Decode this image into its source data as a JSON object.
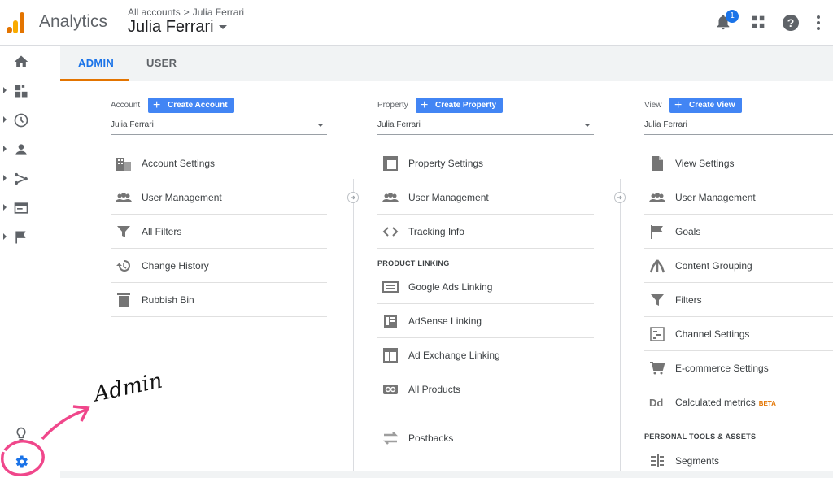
{
  "header": {
    "app_name": "Analytics",
    "breadcrumb": {
      "root": "All accounts",
      "separator": ">",
      "current": "Julia Ferrari"
    },
    "account_name": "Julia Ferrari",
    "notification_count": "1"
  },
  "tabs": [
    {
      "label": "ADMIN"
    },
    {
      "label": "USER"
    }
  ],
  "columns": {
    "account": {
      "label": "Account",
      "create_label": "Create Account",
      "selected": "Julia Ferrari",
      "items": [
        {
          "label": "Account Settings",
          "icon": "building-icon"
        },
        {
          "label": "User Management",
          "icon": "people-icon"
        },
        {
          "label": "All Filters",
          "icon": "filter-icon"
        },
        {
          "label": "Change History",
          "icon": "history-icon"
        },
        {
          "label": "Rubbish Bin",
          "icon": "trash-icon"
        }
      ]
    },
    "property": {
      "label": "Property",
      "create_label": "Create Property",
      "selected": "Julia Ferrari",
      "items": [
        {
          "label": "Property Settings",
          "icon": "window-icon"
        },
        {
          "label": "User Management",
          "icon": "people-icon"
        },
        {
          "label": "Tracking Info",
          "icon": "code-icon"
        }
      ],
      "group_label": "PRODUCT LINKING",
      "linking_items": [
        {
          "label": "Google Ads Linking",
          "icon": "ads-icon"
        },
        {
          "label": "AdSense Linking",
          "icon": "adsense-icon"
        },
        {
          "label": "Ad Exchange Linking",
          "icon": "window-icon"
        },
        {
          "label": "All Products",
          "icon": "link-icon"
        }
      ],
      "extra_items": [
        {
          "label": "Postbacks",
          "icon": "swap-icon"
        }
      ]
    },
    "view": {
      "label": "View",
      "create_label": "Create View",
      "selected": "Julia Ferrari",
      "items": [
        {
          "label": "View Settings",
          "icon": "file-icon"
        },
        {
          "label": "User Management",
          "icon": "people-icon"
        },
        {
          "label": "Goals",
          "icon": "flag-icon"
        },
        {
          "label": "Content Grouping",
          "icon": "grouping-icon"
        },
        {
          "label": "Filters",
          "icon": "filter-icon"
        },
        {
          "label": "Channel Settings",
          "icon": "channel-icon"
        },
        {
          "label": "E-commerce Settings",
          "icon": "cart-icon"
        },
        {
          "label": "Calculated metrics",
          "icon": "dd-icon",
          "badge": "BETA"
        }
      ],
      "group_label": "PERSONAL TOOLS & ASSETS",
      "tools_items": [
        {
          "label": "Segments",
          "icon": "segments-icon"
        }
      ]
    }
  },
  "annotation": {
    "text": "Admin"
  },
  "colors": {
    "accent": "#1a73e8",
    "button": "#4285f4",
    "tab_underline": "#e37400",
    "annotation_pink": "#f0478b"
  }
}
